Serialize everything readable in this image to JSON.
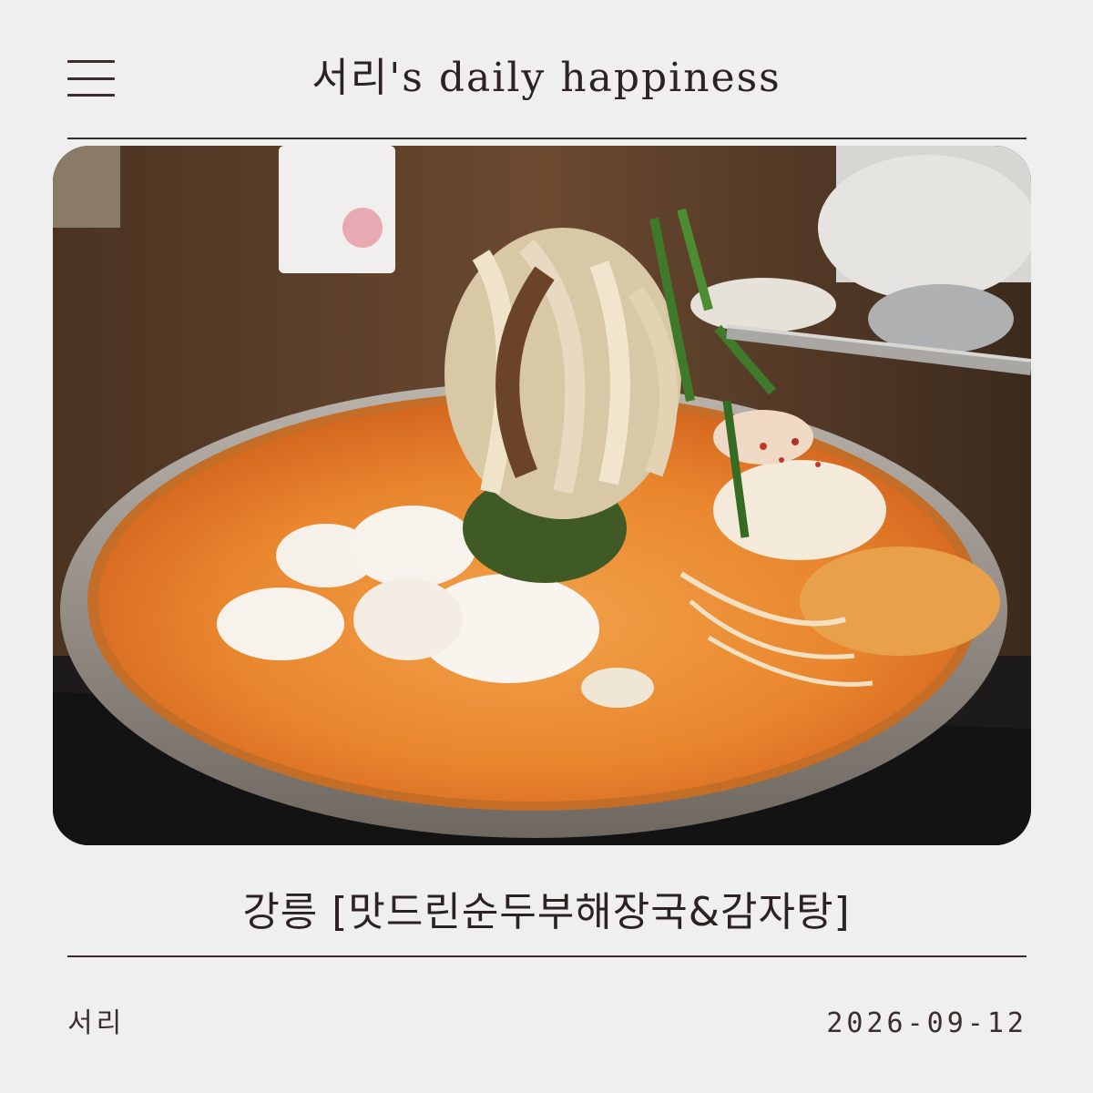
{
  "header": {
    "title": "서리's daily happiness",
    "menu_icon": "hamburger-menu-icon"
  },
  "photo": {
    "subject": "food-photo"
  },
  "post": {
    "title": "강릉 [맛드린순두부해장국&감자탕]",
    "author": "서리",
    "date": "2026-09-12"
  },
  "colors": {
    "background": "#efefef",
    "text": "#2b2221",
    "rule": "#3a2d2c"
  }
}
